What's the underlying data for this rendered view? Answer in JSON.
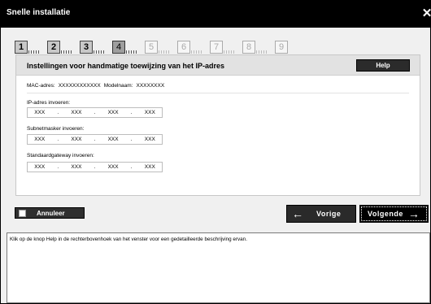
{
  "window": {
    "title": "Snelle installatie",
    "close_icon": "close-icon"
  },
  "steps": [
    {
      "label": "1",
      "state": "done"
    },
    {
      "label": "2",
      "state": "done"
    },
    {
      "label": "3",
      "state": "done"
    },
    {
      "label": "4",
      "state": "active"
    },
    {
      "label": "5",
      "state": "todo"
    },
    {
      "label": "6",
      "state": "todo"
    },
    {
      "label": "7",
      "state": "todo"
    },
    {
      "label": "8",
      "state": "todo"
    },
    {
      "label": "9",
      "state": "todo"
    }
  ],
  "panel": {
    "heading": "Instellingen voor handmatige toewijzing van het IP-adres",
    "help_label": "Help",
    "mac_label": "MAC-adres:",
    "mac_value": "XXXXXXXXXXXX",
    "model_label": "Modelnaam:",
    "model_value": "XXXXXXXX",
    "ip_label": "IP-adres invoeren:",
    "ip": [
      "XXX",
      "XXX",
      "XXX",
      "XXX"
    ],
    "subnet_label": "Subnetmasker invoeren:",
    "subnet": [
      "XXX",
      "XXX",
      "XXX",
      "XXX"
    ],
    "gateway_label": "Standaardgateway invoeren:",
    "gateway": [
      "XXX",
      "XXX",
      "XXX",
      "XXX"
    ],
    "separator": "."
  },
  "buttons": {
    "cancel": "Annuleer",
    "prev": "Vorige",
    "next": "Volgende",
    "prev_arrow": "🡐",
    "next_arrow": "🡒"
  },
  "info": {
    "text": "Klik op de knop Help in de rechterbovenhoek van het venster voor een gedetailleerde beschrijving ervan."
  }
}
